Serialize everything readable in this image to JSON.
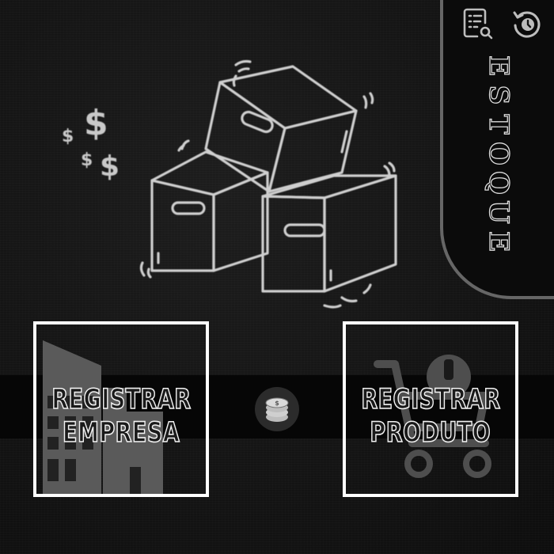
{
  "side_panel": {
    "title_letters": [
      "E",
      "S",
      "T",
      "O",
      "Q",
      "U",
      "E"
    ],
    "search_list_icon": "document-search-icon",
    "history_icon": "history-icon"
  },
  "hero": {
    "illustration": "boxes-illustration",
    "currency_symbols": [
      "$",
      "$",
      "$",
      "$"
    ]
  },
  "actions": {
    "company": {
      "line1": "REGISTRAR",
      "line2": "EMPRESA",
      "icon": "building-icon"
    },
    "product": {
      "line1": "REGISTRAR",
      "line2": "PRODUTO",
      "icon": "shopping-cart-icon"
    },
    "coins_icon": "coins-icon"
  },
  "colors": {
    "background": "#141414",
    "band": "#060606",
    "card_border": "#ffffff",
    "outline": "#cccccc",
    "panel_border": "#666666"
  }
}
